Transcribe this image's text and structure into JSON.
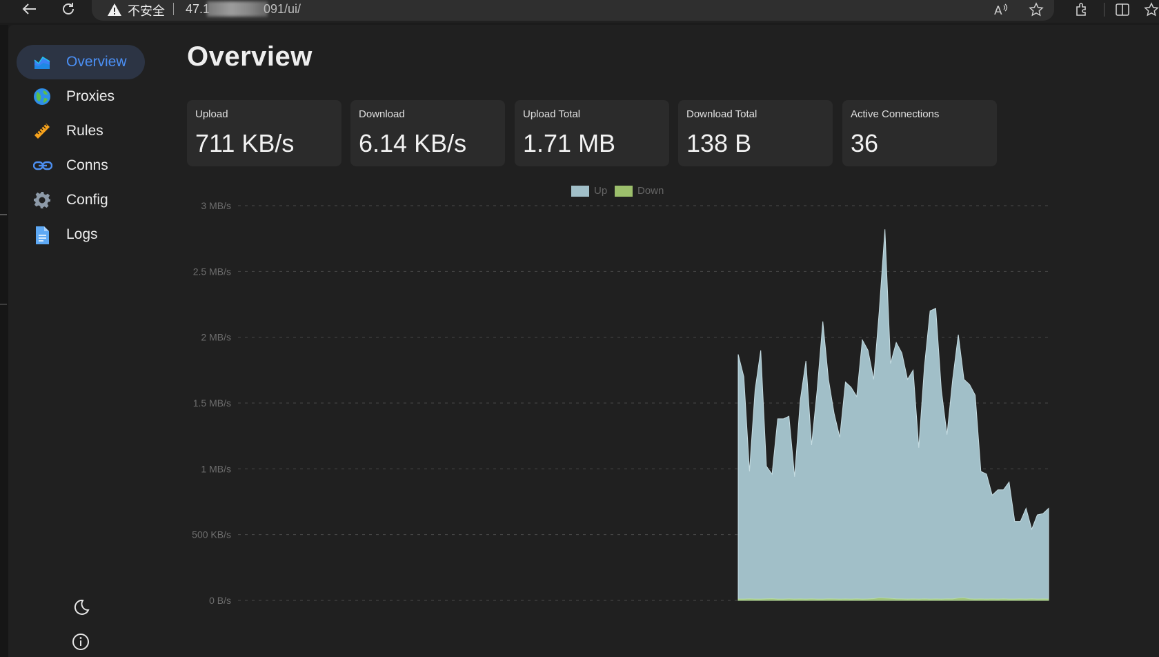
{
  "browser": {
    "security_label": "不安全",
    "url_start": "47.1",
    "url_end": "091/ui/"
  },
  "sidebar": {
    "items": [
      {
        "label": "Overview",
        "icon": "chart-area-icon",
        "active": true
      },
      {
        "label": "Proxies",
        "icon": "globe-icon",
        "active": false
      },
      {
        "label": "Rules",
        "icon": "ruler-icon",
        "active": false
      },
      {
        "label": "Conns",
        "icon": "link-icon",
        "active": false
      },
      {
        "label": "Config",
        "icon": "gear-icon",
        "active": false
      },
      {
        "label": "Logs",
        "icon": "document-icon",
        "active": false
      }
    ],
    "bottom": [
      {
        "icon": "moon-icon"
      },
      {
        "icon": "info-icon"
      }
    ]
  },
  "main": {
    "title": "Overview",
    "stats": [
      {
        "label": "Upload",
        "value": "711 KB/s"
      },
      {
        "label": "Download",
        "value": "6.14 KB/s"
      },
      {
        "label": "Upload Total",
        "value": "1.71 MB"
      },
      {
        "label": "Download Total",
        "value": "138 B"
      },
      {
        "label": "Active Connections",
        "value": "36"
      }
    ]
  },
  "colors": {
    "up": "#a1bfc8",
    "down": "#9cbf6c",
    "accent": "#4b8ff4"
  },
  "chart_data": {
    "type": "area",
    "y_tick_labels": [
      "0 B/s",
      "500 KB/s",
      "1 MB/s",
      "1.5 MB/s",
      "2 MB/s",
      "2.5 MB/s",
      "3 MB/s"
    ],
    "y_unit": "MB/s",
    "ylim": [
      0,
      3
    ],
    "grid": true,
    "legend_position": "top-center",
    "series": [
      {
        "name": "Up",
        "values": [
          1.87,
          1.7,
          0.98,
          1.6,
          1.9,
          1.02,
          0.96,
          1.38,
          1.38,
          1.4,
          0.94,
          1.52,
          1.82,
          1.18,
          1.6,
          2.12,
          1.68,
          1.42,
          1.24,
          1.66,
          1.62,
          1.55,
          1.98,
          1.9,
          1.68,
          2.2,
          2.82,
          1.8,
          1.96,
          1.88,
          1.68,
          1.75,
          1.16,
          1.78,
          2.2,
          2.22,
          1.6,
          1.26,
          1.68,
          2.02,
          1.68,
          1.64,
          1.56,
          0.98,
          0.96,
          0.8,
          0.84,
          0.84,
          0.9,
          0.6,
          0.6,
          0.7,
          0.54,
          0.65,
          0.66,
          0.7
        ],
        "offset_index": 0
      },
      {
        "name": "Down",
        "values": [
          0.01,
          0.01,
          0.012,
          0.01,
          0.01,
          0.012,
          0.013,
          0.01,
          0.01,
          0.012,
          0.01,
          0.011,
          0.01,
          0.012,
          0.01,
          0.01,
          0.012,
          0.011,
          0.01,
          0.011,
          0.01,
          0.012,
          0.01,
          0.011,
          0.013,
          0.02,
          0.018,
          0.015,
          0.012,
          0.011,
          0.01,
          0.011,
          0.01,
          0.012,
          0.01,
          0.011,
          0.01,
          0.012,
          0.011,
          0.018,
          0.02,
          0.012,
          0.01,
          0.011,
          0.01,
          0.011,
          0.01,
          0.012,
          0.01,
          0.01,
          0.011,
          0.01,
          0.012,
          0.01,
          0.011,
          0.01
        ]
      }
    ]
  }
}
